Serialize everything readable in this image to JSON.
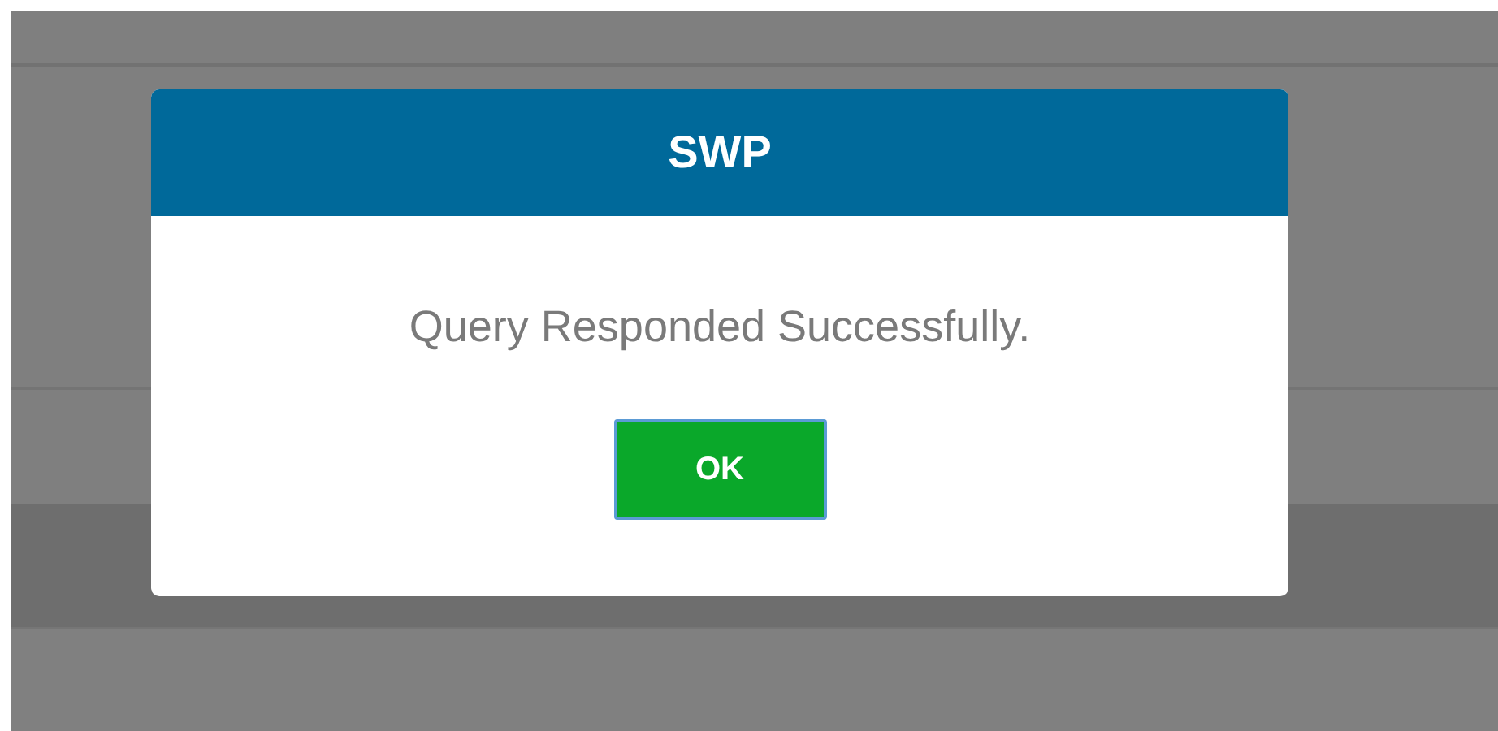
{
  "dialog": {
    "title": "SWP",
    "message": "Query Responded Successfully.",
    "buttons": [
      "OK"
    ]
  }
}
